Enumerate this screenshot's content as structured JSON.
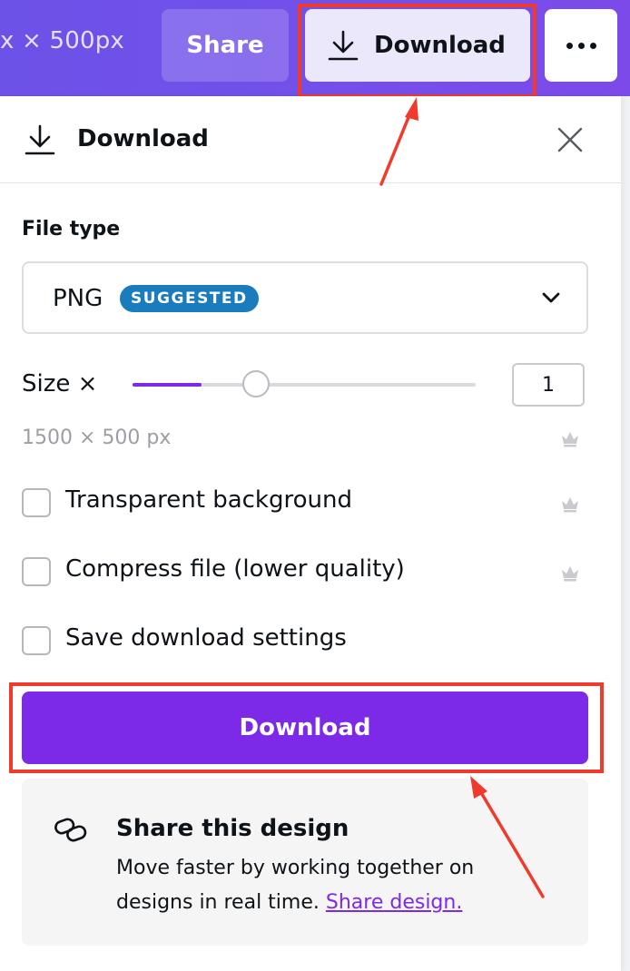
{
  "colors": {
    "accent": "#7d2ae8",
    "topbar": "#7250ea",
    "badge": "#1a7bbd",
    "annotation": "#f03a2c"
  },
  "topbar": {
    "dimensions_text": "x × 500px",
    "share_label": "Share",
    "download_label": "Download",
    "download_icon": "download-icon",
    "more_icon": "more-icon"
  },
  "panel": {
    "title": "Download",
    "title_icon": "download-icon",
    "close_icon": "close-icon",
    "file_type_label": "File type",
    "file_type_value": "PNG",
    "file_type_badge": "SUGGESTED",
    "dropdown_icon": "chevron-down-icon",
    "size_label": "Size ×",
    "size_value": "1",
    "size_slider_level": 0.2,
    "dimensions": "1500 × 500 px",
    "premium_icon": "crown-icon",
    "options": [
      {
        "label": "Transparent background",
        "checked": false,
        "premium": true
      },
      {
        "label": "Compress file (lower quality)",
        "checked": false,
        "premium": true
      },
      {
        "label": "Save download settings",
        "checked": false,
        "premium": false
      }
    ],
    "download_button": "Download"
  },
  "share_card": {
    "icon": "link-icon",
    "title": "Share this design",
    "description": "Move faster by working together on designs in real time.",
    "link_text": "Share design."
  }
}
